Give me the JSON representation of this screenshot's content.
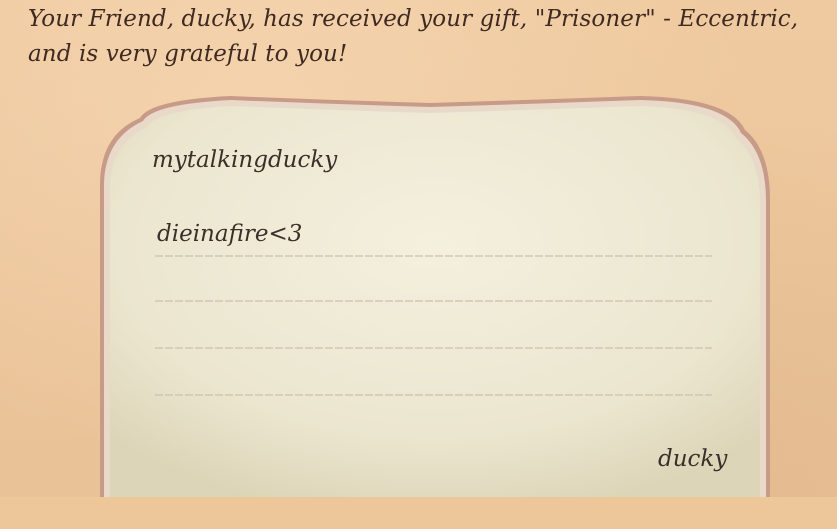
{
  "notification": {
    "text": "Your Friend, ducky, has received your gift, \"Prisoner\" - Eccentric, and is very grateful to you!"
  },
  "card": {
    "recipient": "mytalkingducky",
    "message": "dieinafire<3",
    "signature": "ducky"
  },
  "colors": {
    "background": "#edc79c",
    "card_paper": "#f2edd8",
    "card_border": "#b07f74",
    "text": "#3b2f2a"
  }
}
